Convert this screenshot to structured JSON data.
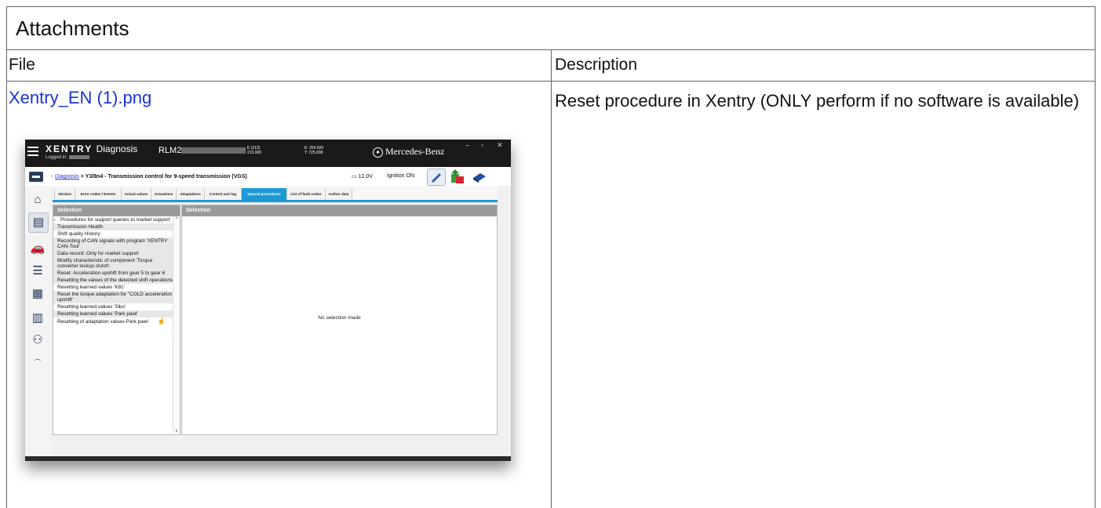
{
  "table": {
    "title": "Attachments",
    "col_file": "File",
    "col_description": "Description",
    "row": {
      "file_link": "Xentry_EN (1).png",
      "description": "Reset procedure in Xentry (ONLY perform if no software is available)"
    }
  },
  "screenshot": {
    "brand_bold": "XENTRY",
    "brand_rest": "Diagnosis",
    "logged_in_label": "Logged in:",
    "vin_prefix": "RLM2",
    "engine_line1": "E (213)",
    "engine_line2": "213.000",
    "odo_line1": "E: 264.920",
    "odo_line2": "T: 725.008",
    "manufacturer": "Mercedes-Benz",
    "breadcrumb_link": "Diagnosis",
    "breadcrumb_rest": "Y3/8n4 - Transmission control for 9-speed transmission (VGS)",
    "battery": "12.0V",
    "ignition": "Ignition ON",
    "tabs": [
      "Version",
      "Error codes / Events",
      "Actual values",
      "Actuations",
      "Adaptations",
      "Control unit log",
      "Special procedures",
      "List of fault codes",
      "Author data"
    ],
    "active_tab": "Special procedures",
    "left_header": "Selection",
    "right_header": "Selection",
    "procedures": [
      "Procedures for support queries to market support",
      "Transmission Health",
      "Shift quality History",
      "Recording of CAN signals with program 'XENTRY CAN-Tool'",
      "Data record: Only for market support",
      "Modify characteristic of component 'Torque converter lockup clutch'.",
      "Reset: Acceleration upshift from gear 5 to gear 6",
      " Resetting the values of the detected shift operations",
      "Resetting learned values 'K81'",
      "Reset the torque adaptation for \"COLD acceleration upshift'",
      "Resetting learned values 'Siko'",
      "Resetting learned values 'Park pawl'",
      "Resetting of adaptation values Park pawl"
    ],
    "empty_message": "No selection made",
    "sidebar_icons": [
      "home-icon",
      "diagnosis-icon",
      "vehicle-icon",
      "list-icon",
      "grid-icon",
      "document-icon",
      "user-lock-icon",
      "xrd-icon"
    ],
    "colors": {
      "accent": "#1d9ad6",
      "header_gray": "#9a9a9a",
      "topbar": "#1a1a1a",
      "link": "#1a33d8"
    }
  }
}
